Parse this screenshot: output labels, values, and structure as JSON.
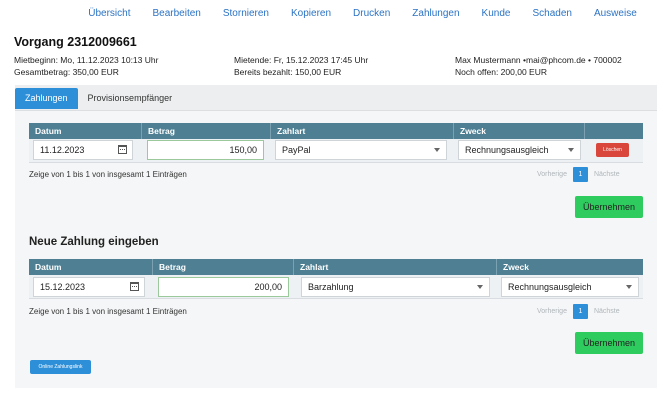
{
  "nav": [
    "Übersicht",
    "Bearbeiten",
    "Stornieren",
    "Kopieren",
    "Drucken",
    "Zahlungen",
    "Kunde",
    "Schaden",
    "Ausweise"
  ],
  "vorgang": {
    "title": "Vorgang 2312009661",
    "mietbeginn": "Mietbeginn: Mo, 11.12.2023 10:13 Uhr",
    "gesamtbetrag": "Gesamtbetrag: 350,00 EUR",
    "mietende": "Mietende: Fr, 15.12.2023 17:45 Uhr",
    "bezahlt": "Bereits bezahlt: 150,00 EUR",
    "kunde": "Max Mustermann •mai@phcom.de • 700002",
    "offen": "Noch offen: 200,00 EUR"
  },
  "tabs": [
    "Zahlungen",
    "Provisionsempfänger"
  ],
  "table1": {
    "headers": [
      "Datum",
      "Betrag",
      "Zahlart",
      "Zweck"
    ],
    "row": {
      "datum": "11.12.2023",
      "betrag": "150,00",
      "zahlart": "PayPal",
      "zweck": "Rechnungsausgleich",
      "delete": "Löschen"
    },
    "info": "Zeige von 1 bis 1 von insgesamt 1 Einträgen",
    "prev": "Vorherige",
    "page": "1",
    "next": "Nächste",
    "submit": "Übernehmen"
  },
  "new_section": "Neue Zahlung eingeben",
  "table2": {
    "headers": [
      "Datum",
      "Betrag",
      "Zahlart",
      "Zweck"
    ],
    "row": {
      "datum": "15.12.2023",
      "betrag": "200,00",
      "zahlart": "Barzahlung",
      "zweck": "Rechnungsausgleich"
    },
    "info": "Zeige von 1 bis 1 von insgesamt 1 Einträgen",
    "prev": "Vorherige",
    "page": "1",
    "next": "Nächste",
    "submit": "Übernehmen"
  },
  "online_link": "Online Zahlungslink"
}
